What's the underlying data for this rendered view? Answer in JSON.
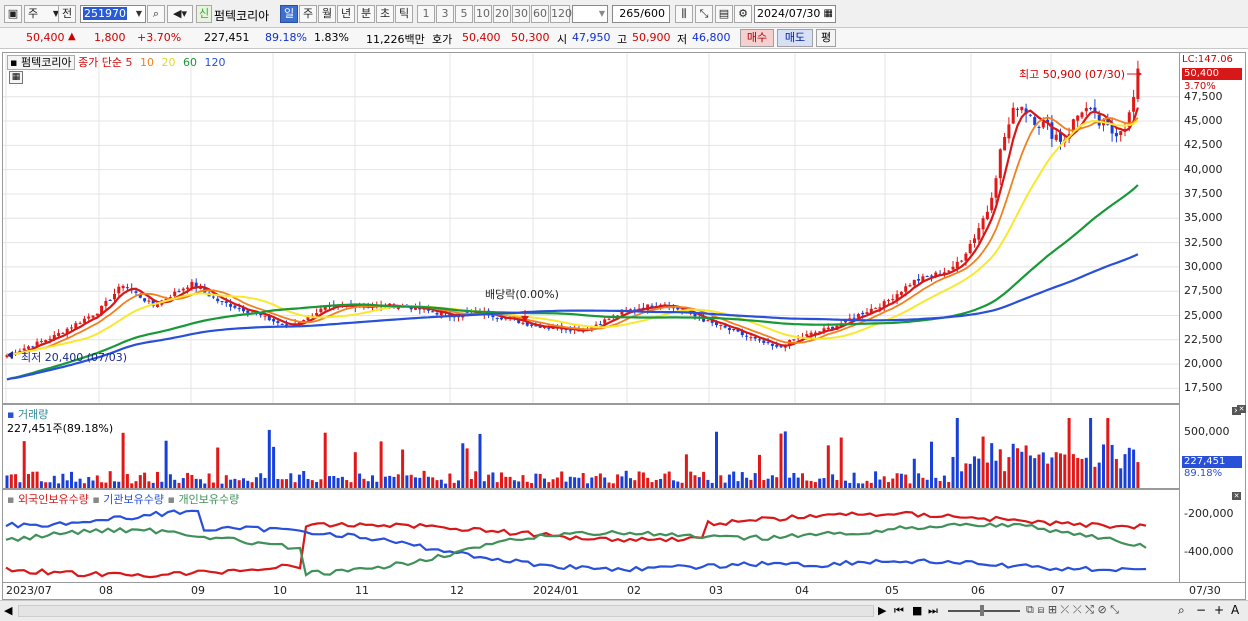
{
  "toolbar": {
    "market": "주",
    "view": "전",
    "code": "251970",
    "new_badge": "신",
    "stock_name": "펌텍코리아",
    "period_buttons": [
      "일",
      "주",
      "월",
      "년",
      "분",
      "초",
      "틱"
    ],
    "interval_buttons": [
      "1",
      "3",
      "5",
      "10",
      "20",
      "30",
      "60",
      "120"
    ],
    "count": "265",
    "count_total": "/600",
    "date": "2024/07/30"
  },
  "quote": {
    "price": "50,400",
    "change": "1,800",
    "change_pct": "+3.70%",
    "volume": "227,451",
    "volume_ratio": "89.18%",
    "turnover_pct": "1.83%",
    "amount": "11,226백만",
    "ask_label": "호가",
    "ask": "50,400",
    "bid": "50,300",
    "open_label": "시",
    "open": "47,950",
    "high_label": "고",
    "high": "50,900",
    "low_label": "저",
    "low": "46,800",
    "buy_label": "매수",
    "sell_label": "매도",
    "eval_label": "평"
  },
  "price_pane": {
    "stock_tag": "펌텍코리아",
    "legend_title": "종가 단순",
    "ma_periods": [
      "5",
      "10",
      "20",
      "60",
      "120"
    ],
    "ma_colors": [
      "#d81818",
      "#f08020",
      "#f8e830",
      "#189838",
      "#2850d8"
    ],
    "high_annotation": "최고 50,900 (07/30)",
    "low_annotation": "최저 20,400 (07/03)",
    "dividend_annotation": "배당락(0.00%)",
    "lc_label": "LC:147.06",
    "last_price_tag": "50,400",
    "last_pct_tag": "3.70%",
    "y_ticks": [
      "47,500",
      "45,000",
      "42,500",
      "40,000",
      "37,500",
      "35,000",
      "32,500",
      "30,000",
      "27,500",
      "25,000",
      "22,500",
      "20,000",
      "17,500"
    ]
  },
  "volume_pane": {
    "title": "거래량",
    "current": "227,451주(89.18%)",
    "y_tick": "500,000",
    "tag_value": "227,451",
    "tag_pct": "89.18%"
  },
  "ownership_pane": {
    "legends": [
      "외국인보유수량",
      "기관보유수량",
      "개인보유수량"
    ],
    "legend_colors": [
      "#d81818",
      "#2850d8",
      "#40905a"
    ],
    "y_ticks": [
      "-200,000",
      "-400,000"
    ]
  },
  "date_axis": {
    "labels": [
      "2023/07",
      "08",
      "09",
      "10",
      "11",
      "12",
      "2024/01",
      "02",
      "03",
      "04",
      "05",
      "06",
      "07"
    ],
    "right_label": "07/30"
  },
  "chart_data": {
    "type": "candlestick",
    "title": "",
    "y_range": [
      16000,
      52000
    ],
    "points": [
      {
        "date": "2023/07/03",
        "close": 20900,
        "low": 20400
      },
      {
        "date": "2023/08",
        "close": 28000
      },
      {
        "date": "2023/09",
        "close": 28000
      },
      {
        "date": "2023/10",
        "close": 23500
      },
      {
        "date": "2023/11",
        "close": 26500
      },
      {
        "date": "2023/12",
        "close": 25000
      },
      {
        "date": "2024/01",
        "close": 24200
      },
      {
        "date": "2024/02",
        "close": 26200
      },
      {
        "date": "2024/03",
        "close": 23500
      },
      {
        "date": "2024/04",
        "close": 22500
      },
      {
        "date": "2024/05",
        "close": 26800
      },
      {
        "date": "2024/06",
        "close": 42000
      },
      {
        "date": "2024/07",
        "close": 45500
      },
      {
        "date": "2024/07/30",
        "close": 50400,
        "high": 50900
      }
    ],
    "moving_averages": [
      {
        "name": "5",
        "last": 47000
      },
      {
        "name": "10",
        "last": 45500
      },
      {
        "name": "20",
        "last": 45300
      },
      {
        "name": "60",
        "last": 39200
      },
      {
        "name": "120",
        "last": 31500
      }
    ]
  }
}
